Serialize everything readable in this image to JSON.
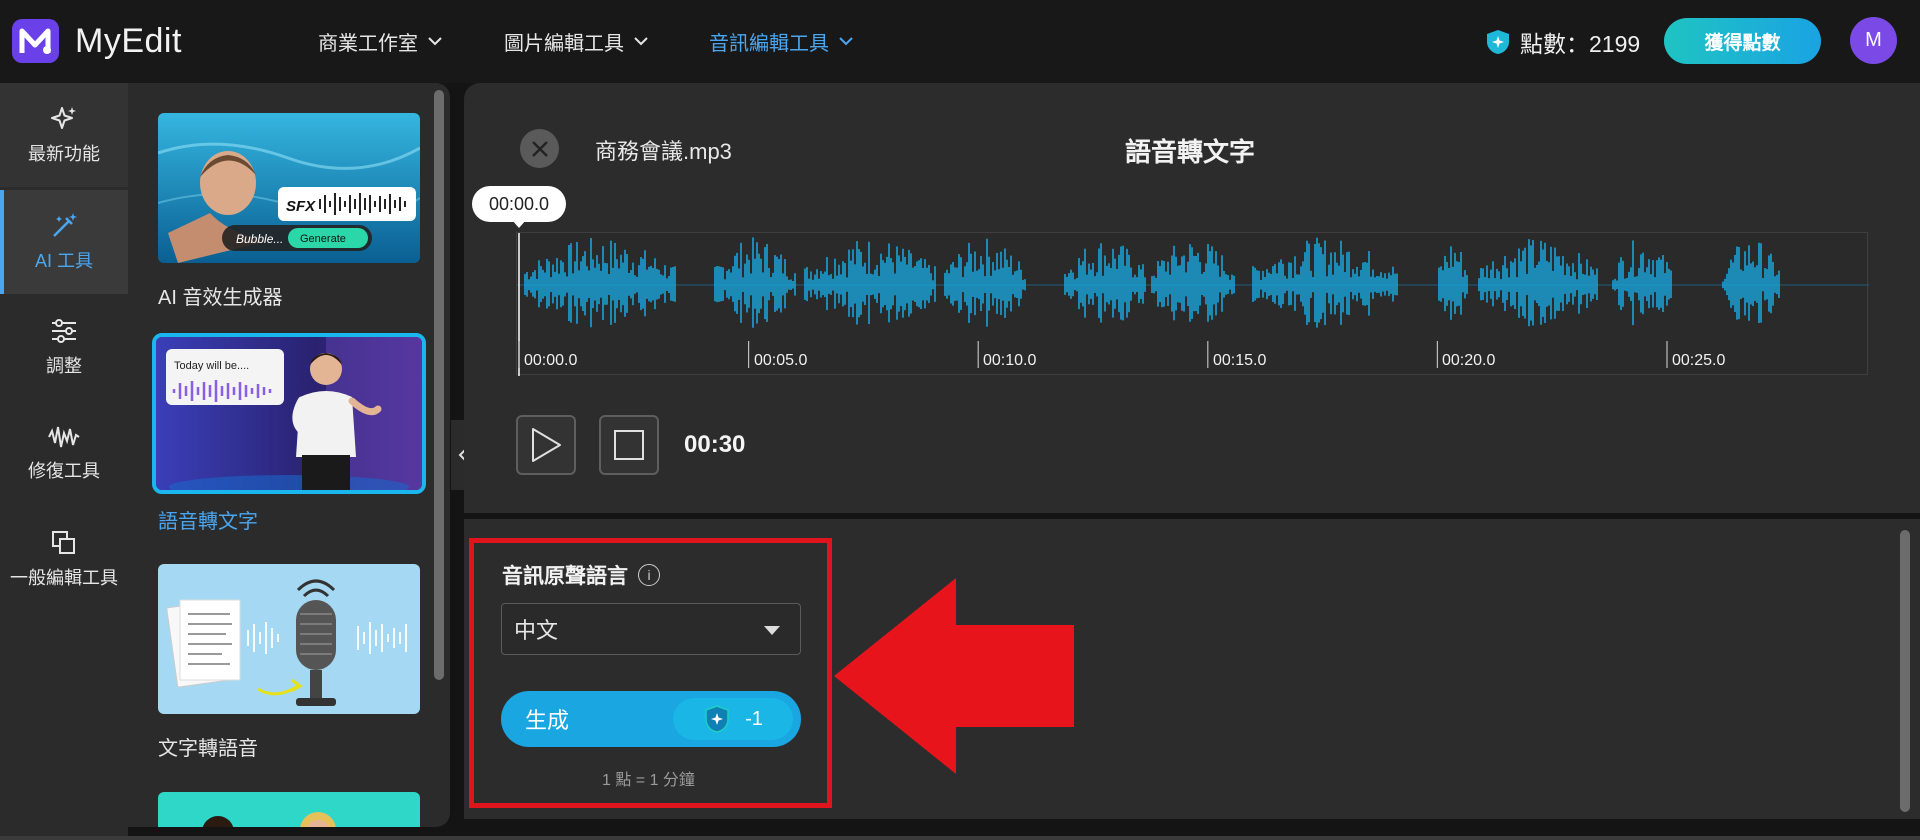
{
  "app": {
    "brand": "MyEdit",
    "logo_letter": "M"
  },
  "nav": [
    {
      "label": "商業工作室",
      "active": false
    },
    {
      "label": "圖片編輯工具",
      "active": false
    },
    {
      "label": "音訊編輯工具",
      "active": true
    }
  ],
  "account": {
    "points_label": "點數：2199",
    "get_points": "獲得點數",
    "avatar_letter": "M"
  },
  "rail": [
    {
      "label": "最新功能",
      "icon": "sparkle-icon"
    },
    {
      "label": "AI 工具",
      "icon": "magic-wand-icon"
    },
    {
      "label": "調整",
      "icon": "sliders-icon"
    },
    {
      "label": "修復工具",
      "icon": "waveform-icon"
    },
    {
      "label": "一般編輯工具",
      "icon": "layers-icon"
    }
  ],
  "tools": [
    {
      "label": "AI 音效生成器",
      "thumb_text_1": "SFX",
      "thumb_text_2": "Bubble...",
      "thumb_button": "Generate"
    },
    {
      "label": "語音轉文字",
      "thumb_text": "Today will be...."
    },
    {
      "label": "文字轉語音"
    }
  ],
  "editor": {
    "filename": "商務會議.mp3",
    "title": "語音轉文字",
    "current_time": "00:00.0",
    "ticks": [
      "00:00.0",
      "00:05.0",
      "00:10.0",
      "00:15.0",
      "00:20.0",
      "00:25.0"
    ],
    "duration": "00:30",
    "wave_color": "#1aa3d8"
  },
  "settings": {
    "language_label": "音訊原聲語言",
    "info_symbol": "i",
    "language_value": "中文",
    "generate_label": "生成",
    "cost": "-1",
    "note": "1 點 = 1 分鐘"
  },
  "colors": {
    "accent": "#4aa6f0",
    "highlight": "#e0141c",
    "arrow": "#e8141c"
  }
}
